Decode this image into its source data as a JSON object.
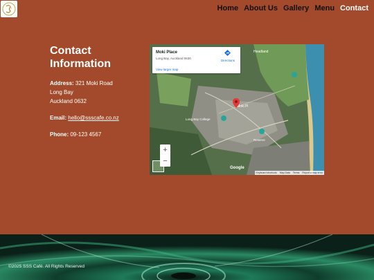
{
  "header": {
    "logo_text": "SSS",
    "nav": [
      "Home",
      "About Us",
      "Gallery",
      "Menu",
      "Contact"
    ],
    "active": "Contact"
  },
  "contact": {
    "title_line1": "Contact",
    "title_line2": "Information",
    "address_label": "Address:",
    "address_line1": "321 Moki Road",
    "address_line2": "Long Bay",
    "address_line3": "Auckland 0632",
    "email_label": "Email:",
    "email": "hello@ssscafe.co.nz",
    "phone_label": "Phone:",
    "phone": "09-123 4567"
  },
  "map": {
    "place_name": "Moki Place",
    "place_address": "Long Bay, Auckland 0630",
    "directions_label": "Directions",
    "larger_map_label": "View larger map",
    "zoom_in": "+",
    "zoom_out": "−",
    "google_label": "Google",
    "attribution": [
      "Keyboard shortcuts",
      "Map Data",
      "Terms",
      "Report a map error"
    ],
    "colors": {
      "water": "#3d8fb0",
      "pin": "#e53935",
      "poi": "#26a69a"
    }
  },
  "footer": {
    "copyright": "©2025 SSS Café. All Rights Reserved"
  }
}
